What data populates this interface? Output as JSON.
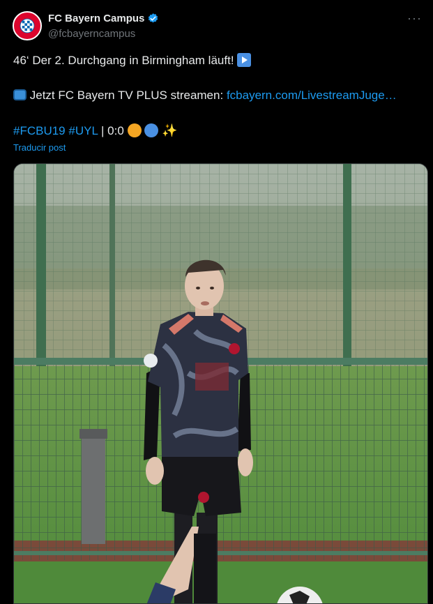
{
  "account": {
    "display_name": "FC Bayern Campus",
    "handle": "@fcbayerncampus",
    "verified": true,
    "avatar_icon": "fc-bayern-logo-icon",
    "more_label": "···"
  },
  "post": {
    "line1_text": "46‘ Der 2. Durchgang in Birmingham läuft!",
    "line2_prefix": "Jetzt FC Bayern TV PLUS streamen:",
    "line2_link": "fcbayern.com/LivestreamJuge…",
    "hashtag1": "#FCBU19",
    "hashtag2": "#UYL",
    "score_text": "| 0:0",
    "sparkle": "✨",
    "translate_label": "Traducir post"
  },
  "media": {
    "description_icon": "player-photo",
    "colors": {
      "accent": "#1d9bf0",
      "bayern_red": "#dc052d"
    }
  }
}
